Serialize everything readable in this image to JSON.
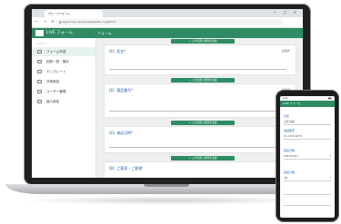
{
  "browser": {
    "tab_title": "グループフォーム",
    "window_buttons": "— □ ✕",
    "nav_icons": "← → ⟳",
    "url": "▲ wg-survey-app.groupsession.co.jp/form"
  },
  "app": {
    "title": "LIVE フォーム",
    "header_tab": "フォーム"
  },
  "sidebar": {
    "heading": "メニュー",
    "items": [
      {
        "label": "フォーム作成"
      },
      {
        "label": "回答一覧・集計"
      },
      {
        "label": "テンプレート"
      },
      {
        "label": "共有設定"
      },
      {
        "label": "ユーザー管理"
      },
      {
        "label": "個人設定"
      }
    ]
  },
  "main": {
    "add_label": "+ この位置に質問を追加",
    "questions": [
      {
        "number": "Q1.",
        "text": "氏名",
        "required": "*",
        "meta": "記述式"
      },
      {
        "number": "Q2.",
        "text": "電話番号",
        "required": "*",
        "meta": "記述式"
      },
      {
        "number": "Q3.",
        "text": "来店日時",
        "required": "*",
        "meta": "日付"
      },
      {
        "number": "Q4.",
        "text": "ご意見・ご要望",
        "required": "",
        "meta": "段落"
      }
    ],
    "fab": {
      "add": "+",
      "copy": "❐",
      "delete": "✕"
    }
  },
  "phone": {
    "time": "9:41",
    "signal": "▮▮▮",
    "title": "LIVE フォーム",
    "fields": [
      {
        "label": "氏名",
        "value": "山田 太郎"
      },
      {
        "label": "電話番号",
        "value": "03-1234-5678"
      },
      {
        "label": "来店日時",
        "value": "2023/04/01"
      },
      {
        "label": "来店人数",
        "value": "2名"
      }
    ],
    "dropdown_caret": "▾"
  },
  "colors": {
    "brand_green": "#2e8b63",
    "question_blue": "#1a5fb4",
    "required_red": "#d32f2f",
    "copy_blue": "#3f51b5"
  }
}
